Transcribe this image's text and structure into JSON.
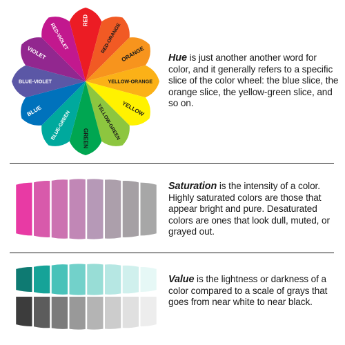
{
  "hue": {
    "term": "Hue",
    "text": " is just another another word for color, and it generally refers to a specific slice of the color wheel: the blue slice, the orange slice, the yellow-green slice, and so on.",
    "wheel": [
      {
        "label": "RED",
        "color": "#ec1c24",
        "text_color": "#ffffff"
      },
      {
        "label": "RED-ORANGE",
        "color": "#f15a24",
        "text_color": "#1a1a1a"
      },
      {
        "label": "ORANGE",
        "color": "#f7941d",
        "text_color": "#1a1a1a"
      },
      {
        "label": "YELLOW-ORANGE",
        "color": "#fbb117",
        "text_color": "#1a1a1a"
      },
      {
        "label": "YELLOW",
        "color": "#fff200",
        "text_color": "#1a1a1a"
      },
      {
        "label": "YELLOW-GREEN",
        "color": "#8dc63f",
        "text_color": "#1a1a1a"
      },
      {
        "label": "GREEN",
        "color": "#00a651",
        "text_color": "#1a1a1a"
      },
      {
        "label": "BLUE-GREEN",
        "color": "#00a99d",
        "text_color": "#ffffff"
      },
      {
        "label": "BLUE",
        "color": "#0072bc",
        "text_color": "#ffffff"
      },
      {
        "label": "BLUE-VIOLET",
        "color": "#5b57a6",
        "text_color": "#ffffff"
      },
      {
        "label": "VIOLET",
        "color": "#92278f",
        "text_color": "#ffffff"
      },
      {
        "label": "RED-VIOLET",
        "color": "#c2188e",
        "text_color": "#ffffff"
      }
    ]
  },
  "saturation": {
    "term": "Saturation",
    "text": " is the intensity of a color. Highly saturated colors are those that appear bright and pure. Desaturated colors are ones that look dull, muted, or grayed out.",
    "swatches": [
      "#e83aa4",
      "#d85aab",
      "#cc72b1",
      "#c187b6",
      "#b699b7",
      "#ac9fab",
      "#a5a0a4",
      "#a7a7a7"
    ]
  },
  "value": {
    "term": "Value",
    "text": " is the lightness or darkness of a color compared to a scale of grays that goes from near white to near black.",
    "color_swatches": [
      "#0e7a72",
      "#16a398",
      "#48c2b9",
      "#72d1ca",
      "#98ddd6",
      "#b6e7e3",
      "#d0f0ed",
      "#e6f8f6"
    ],
    "gray_swatches": [
      "#3c3c3c",
      "#5c5c5c",
      "#7b7b7b",
      "#999999",
      "#b4b4b4",
      "#cccccc",
      "#e0e0e0",
      "#ededed"
    ]
  }
}
